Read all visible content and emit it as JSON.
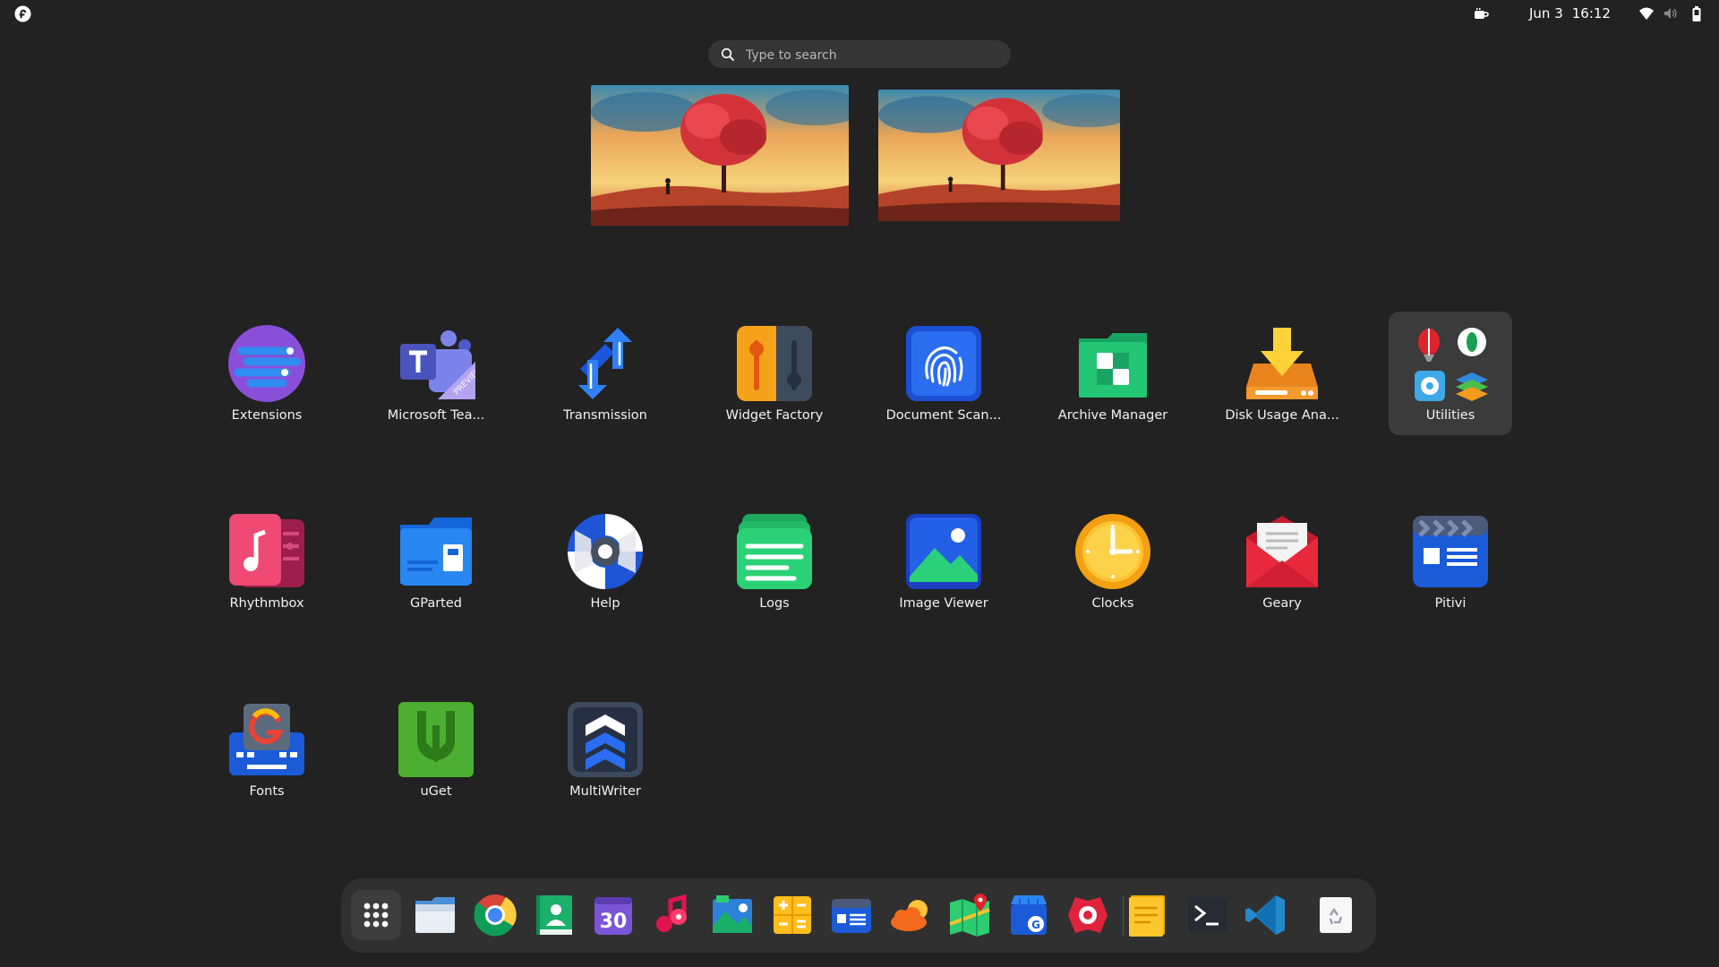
{
  "top_bar": {
    "date": "Jun 3",
    "time": "16:12",
    "logo_icon": "fedora-logo-icon",
    "tray_icons": [
      "coffee-cup-icon",
      "wifi-icon",
      "volume-icon",
      "battery-icon"
    ]
  },
  "search": {
    "placeholder": "Type to search",
    "value": ""
  },
  "workspaces": [
    {
      "name": "workspace-1",
      "thumbnail": "red tree at sunset wallpaper"
    },
    {
      "name": "workspace-2",
      "thumbnail": "red tree at sunset wallpaper"
    }
  ],
  "apps": [
    {
      "label": "Extensions",
      "icon": "extensions-icon"
    },
    {
      "label": "Microsoft Tea...",
      "icon": "microsoft-teams-icon"
    },
    {
      "label": "Transmission",
      "icon": "transmission-icon"
    },
    {
      "label": "Widget Factory",
      "icon": "widget-factory-icon"
    },
    {
      "label": "Document Scan...",
      "icon": "document-scanner-icon"
    },
    {
      "label": "Archive Manager",
      "icon": "archive-manager-icon"
    },
    {
      "label": "Disk Usage Ana...",
      "icon": "disk-usage-icon"
    },
    {
      "label": "Utilities",
      "icon": "utilities-folder-icon"
    },
    {
      "label": "Rhythmbox",
      "icon": "rhythmbox-icon"
    },
    {
      "label": "GParted",
      "icon": "gparted-icon"
    },
    {
      "label": "Help",
      "icon": "help-icon"
    },
    {
      "label": "Logs",
      "icon": "logs-icon"
    },
    {
      "label": "Image Viewer",
      "icon": "image-viewer-icon"
    },
    {
      "label": "Clocks",
      "icon": "clocks-icon"
    },
    {
      "label": "Geary",
      "icon": "geary-icon"
    },
    {
      "label": "Pitivi",
      "icon": "pitivi-icon"
    },
    {
      "label": "Fonts",
      "icon": "fonts-icon"
    },
    {
      "label": "uGet",
      "icon": "uget-icon"
    },
    {
      "label": "MultiWriter",
      "icon": "multiwriter-icon"
    }
  ],
  "dock": [
    "show-apps-grid-icon",
    "files-icon",
    "chrome-icon",
    "contacts-icon",
    "calendar-icon",
    "music-icon",
    "photos-icon",
    "calculator-icon",
    "video-editor-icon",
    "weather-icon",
    "maps-icon",
    "software-store-icon",
    "screenshot-icon",
    "notes-icon",
    "terminal-icon",
    "vscode-icon",
    "trash-icon"
  ],
  "dock_calendar_day": "30",
  "colors": {
    "background": "#222222",
    "dock": "#303030",
    "search": "#353535",
    "folder_highlight": "#3b3b3b"
  }
}
